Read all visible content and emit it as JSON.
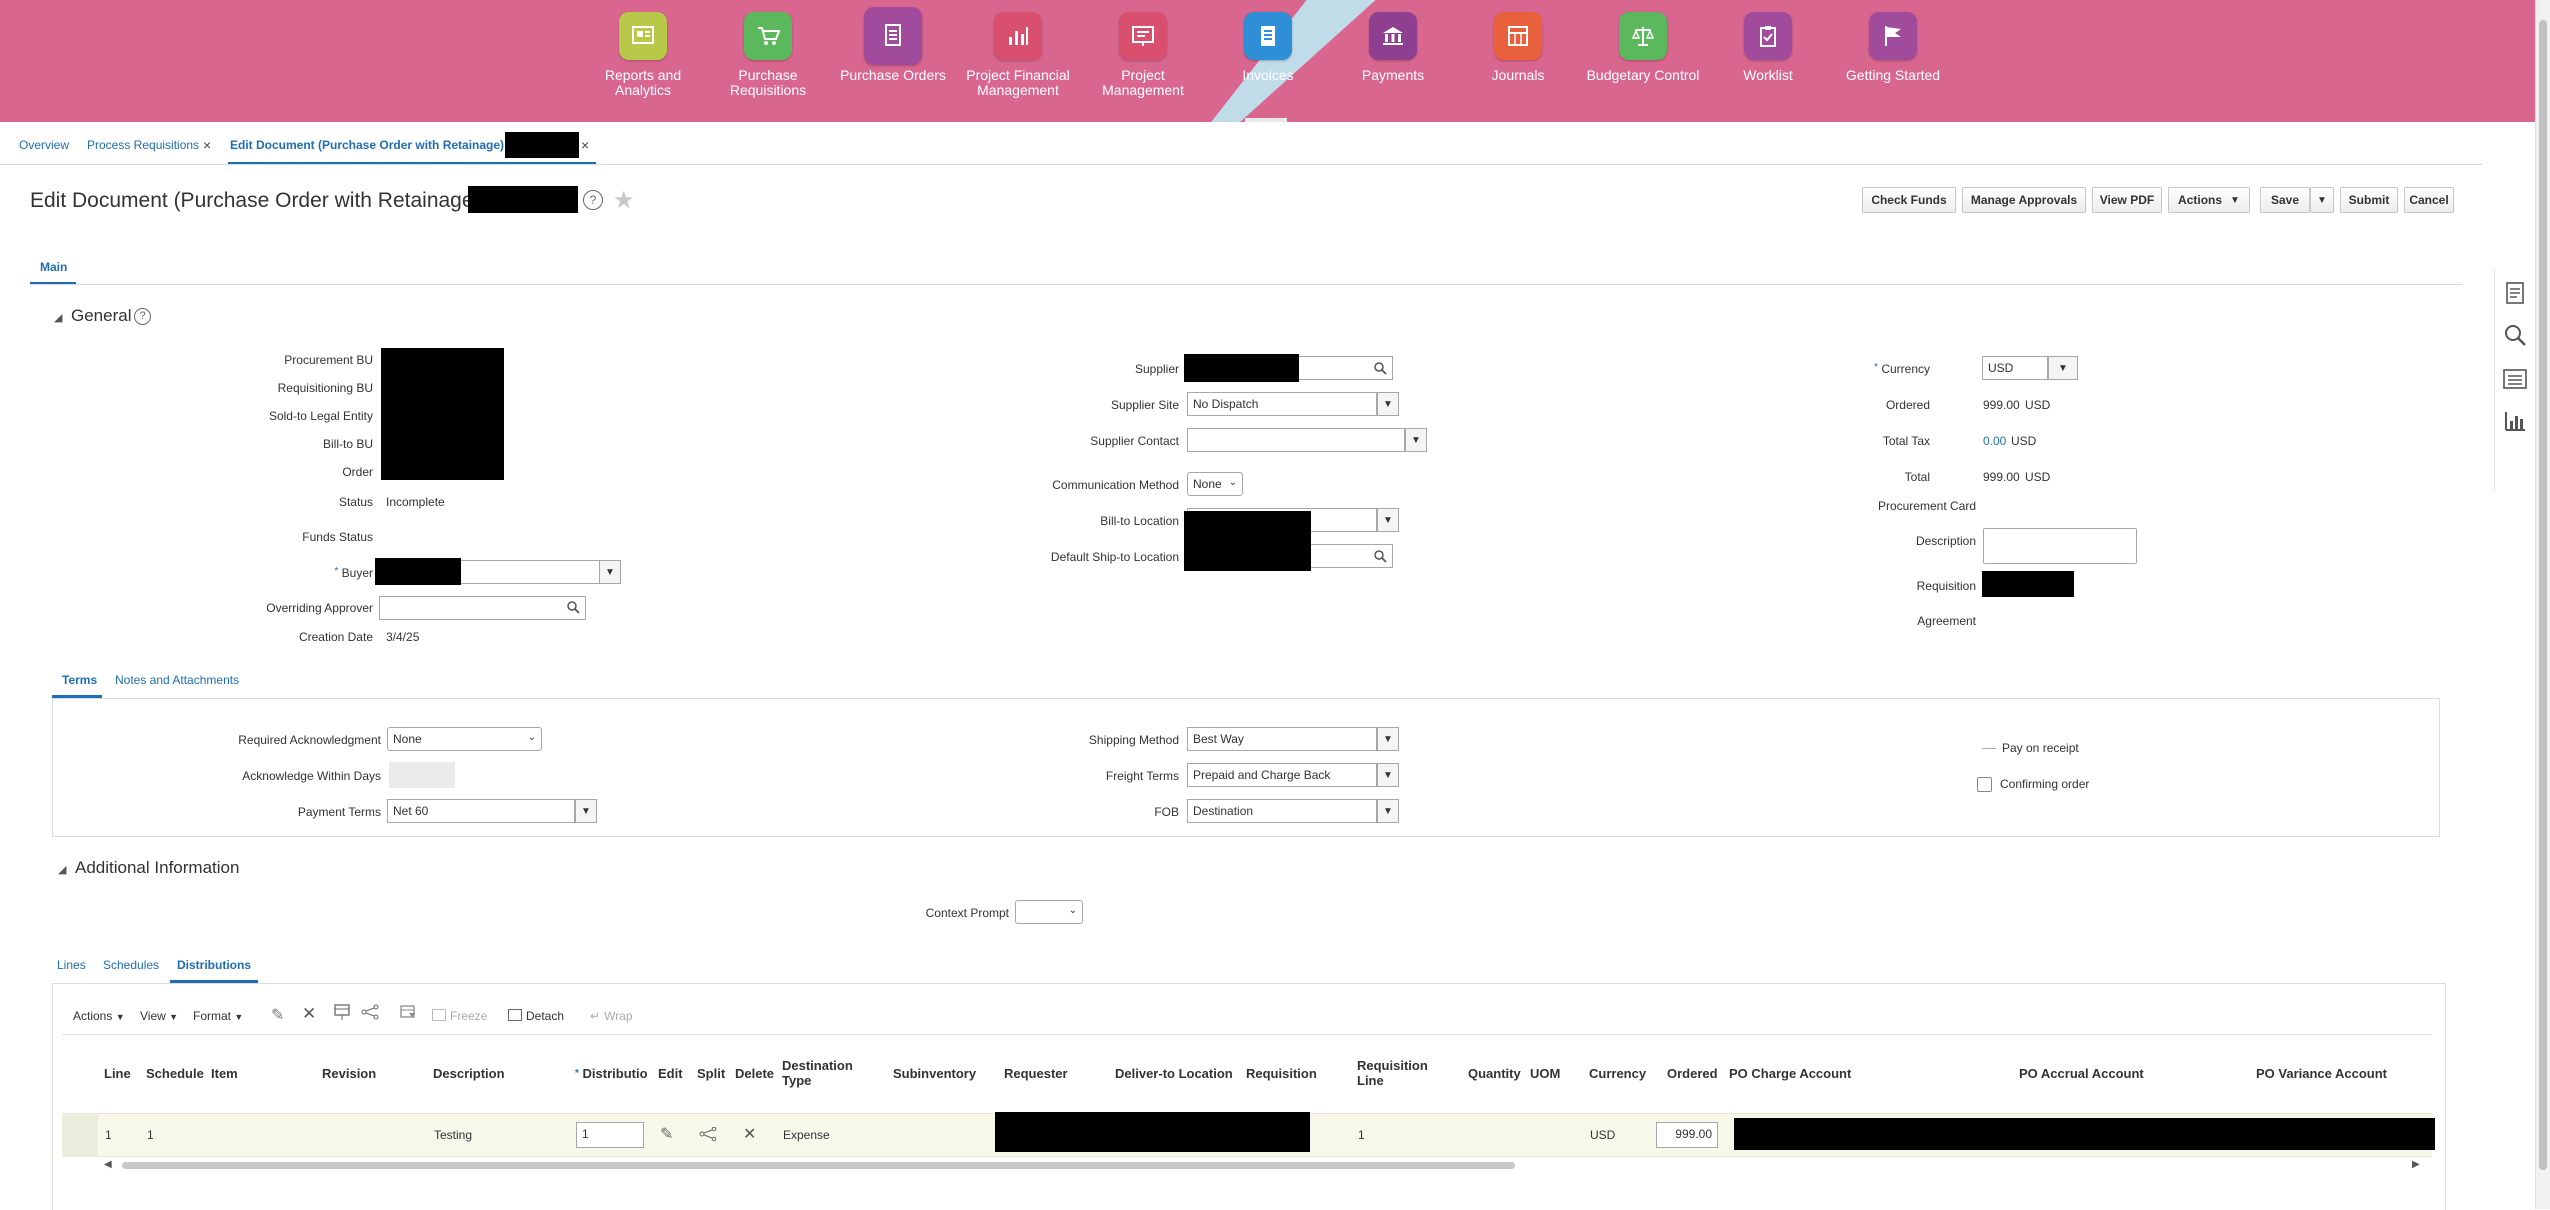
{
  "nav": {
    "items": [
      {
        "label": "Reports and Analytics",
        "color": "#b8c94a"
      },
      {
        "label": "Purchase Requisitions",
        "color": "#5cb85c"
      },
      {
        "label": "Purchase Orders",
        "color": "#a04b9c"
      },
      {
        "label": "Project Financial Management",
        "color": "#d94f6e"
      },
      {
        "label": "Project Management",
        "color": "#d94f6e"
      },
      {
        "label": "Invoices",
        "color": "#2f8fd6"
      },
      {
        "label": "Payments",
        "color": "#8e3f8f"
      },
      {
        "label": "Journals",
        "color": "#e8603c"
      },
      {
        "label": "Budgetary Control",
        "color": "#5cb85c"
      },
      {
        "label": "Worklist",
        "color": "#a04b9c"
      },
      {
        "label": "Getting Started",
        "color": "#a04b9c"
      }
    ]
  },
  "tabs": {
    "overview": "Overview",
    "process_requisitions": "Process Requisitions",
    "edit_document": "Edit Document (Purchase Order with Retainage)",
    "close": "×"
  },
  "header": {
    "title": "Edit Document (Purchase Order with Retainage):",
    "buttons": {
      "check_funds": "Check Funds",
      "manage_approvals": "Manage Approvals",
      "view_pdf": "View PDF",
      "actions": "Actions",
      "save": "Save",
      "submit": "Submit",
      "cancel": "Cancel"
    },
    "main_tab": "Main"
  },
  "general": {
    "title": "General",
    "labels": {
      "procurement_bu": "Procurement BU",
      "requisitioning_bu": "Requisitioning BU",
      "sold_to": "Sold-to Legal Entity",
      "bill_to_bu": "Bill-to BU",
      "order": "Order",
      "status": "Status",
      "funds_status": "Funds Status",
      "buyer": "Buyer",
      "overriding_approver": "Overriding Approver",
      "creation_date": "Creation Date",
      "supplier": "Supplier",
      "supplier_site": "Supplier Site",
      "supplier_contact": "Supplier Contact",
      "communication_method": "Communication Method",
      "bill_to_location": "Bill-to Location",
      "default_ship_to": "Default Ship-to Location",
      "currency": "Currency",
      "ordered": "Ordered",
      "total_tax": "Total Tax",
      "total": "Total",
      "procurement_card": "Procurement Card",
      "description": "Description",
      "requisition": "Requisition",
      "agreement": "Agreement"
    },
    "values": {
      "status": "Incomplete",
      "creation_date": "3/4/25",
      "supplier_site": "No Dispatch",
      "communication_method": "None",
      "currency": "USD",
      "ordered_amount": "999.00",
      "ordered_currency": "USD",
      "total_tax_amount": "0.00",
      "total_tax_currency": "USD",
      "total_amount": "999.00",
      "total_currency": "USD"
    },
    "required_marker": "*"
  },
  "terms": {
    "tab_terms": "Terms",
    "tab_notes": "Notes and Attachments",
    "labels": {
      "required_ack": "Required Acknowledgment",
      "ack_within_days": "Acknowledge Within Days",
      "payment_terms": "Payment Terms",
      "shipping_method": "Shipping Method",
      "freight_terms": "Freight Terms",
      "fob": "FOB",
      "pay_on_receipt": "Pay on receipt",
      "confirming_order": "Confirming order"
    },
    "values": {
      "required_ack": "None",
      "payment_terms": "Net 60",
      "shipping_method": "Best Way",
      "freight_terms": "Prepaid and Charge Back",
      "fob": "Destination"
    }
  },
  "additional": {
    "title": "Additional Information",
    "context_prompt": "Context Prompt"
  },
  "lines": {
    "tabs": {
      "lines": "Lines",
      "schedules": "Schedules",
      "distributions": "Distributions"
    },
    "toolbar": {
      "actions": "Actions",
      "view": "View",
      "format": "Format",
      "freeze": "Freeze",
      "detach": "Detach",
      "wrap": "Wrap"
    },
    "columns": {
      "line": "Line",
      "schedule": "Schedule",
      "item": "Item",
      "revision": "Revision",
      "description": "Description",
      "distribution": "Distributio",
      "edit": "Edit",
      "split": "Split",
      "delete": "Delete",
      "destination_type": "Destination Type",
      "subinventory": "Subinventory",
      "requester": "Requester",
      "deliver_to": "Deliver-to Location",
      "requisition": "Requisition",
      "requisition_line": "Requisition Line",
      "quantity": "Quantity",
      "uom": "UOM",
      "currency": "Currency",
      "ordered": "Ordered",
      "po_charge": "PO Charge Account",
      "po_accrual": "PO Accrual Account",
      "po_variance": "PO Variance Account"
    },
    "row": {
      "line": "1",
      "schedule": "1",
      "description": "Testing",
      "distribution": "1",
      "destination_type": "Expense",
      "requisition_line": "1",
      "currency": "USD",
      "ordered": "999.00"
    }
  }
}
